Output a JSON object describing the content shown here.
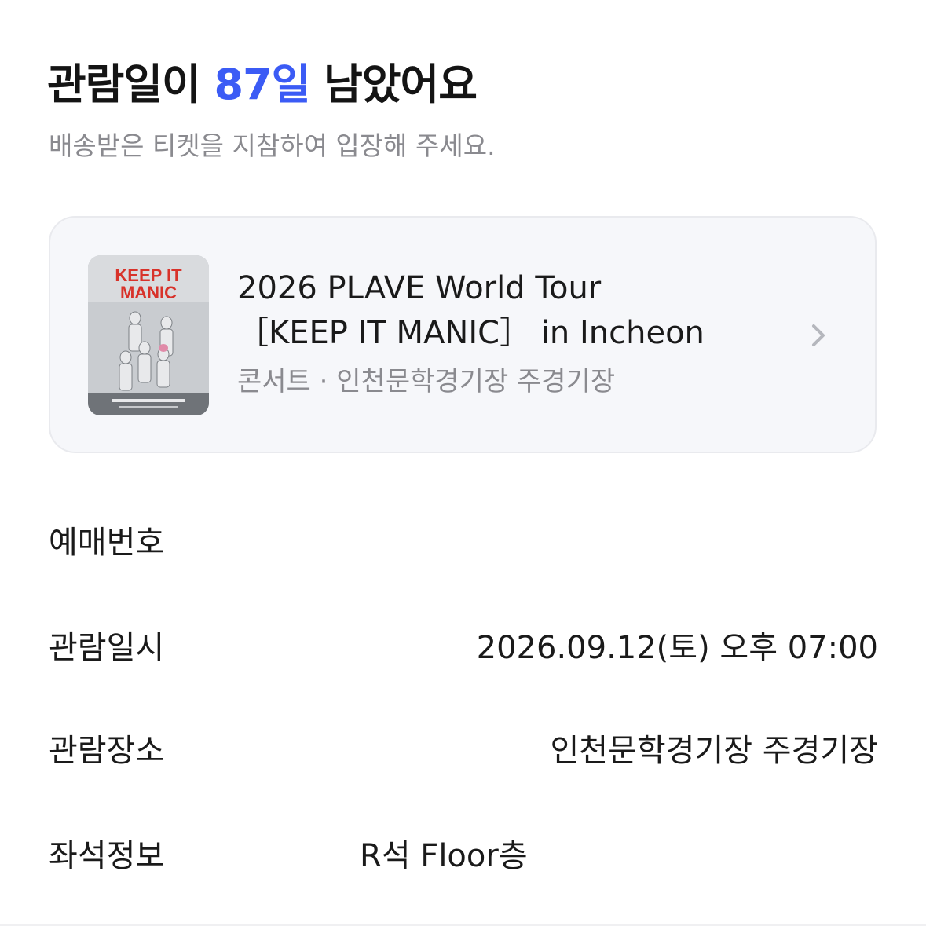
{
  "header": {
    "title_prefix": "관람일이 ",
    "title_days": "87일",
    "title_suffix": " 남았어요",
    "subtitle": "배송받은 티켓을 지참하여 입장해 주세요."
  },
  "event": {
    "title_line1": "2026 PLAVE World Tour",
    "title_line2": "［KEEP IT MANIC］ in Incheon",
    "meta": "콘서트 · 인천문학경기장 주경기장",
    "poster_text": [
      "KEEP IT",
      "MANIC"
    ],
    "icon": "chevron-right-icon"
  },
  "details": {
    "booking_number_label": "예매번호",
    "booking_number_value": "",
    "datetime_label": "관람일시",
    "datetime_value": "2026.09.12(토) 오후 07:00",
    "venue_label": "관람장소",
    "venue_value": "인천문학경기장 주경기장",
    "seat_label": "좌석정보",
    "seat_value": "R석 Floor층"
  },
  "colors": {
    "accent": "#3b5bf5",
    "poster_text": "#d8322a"
  }
}
